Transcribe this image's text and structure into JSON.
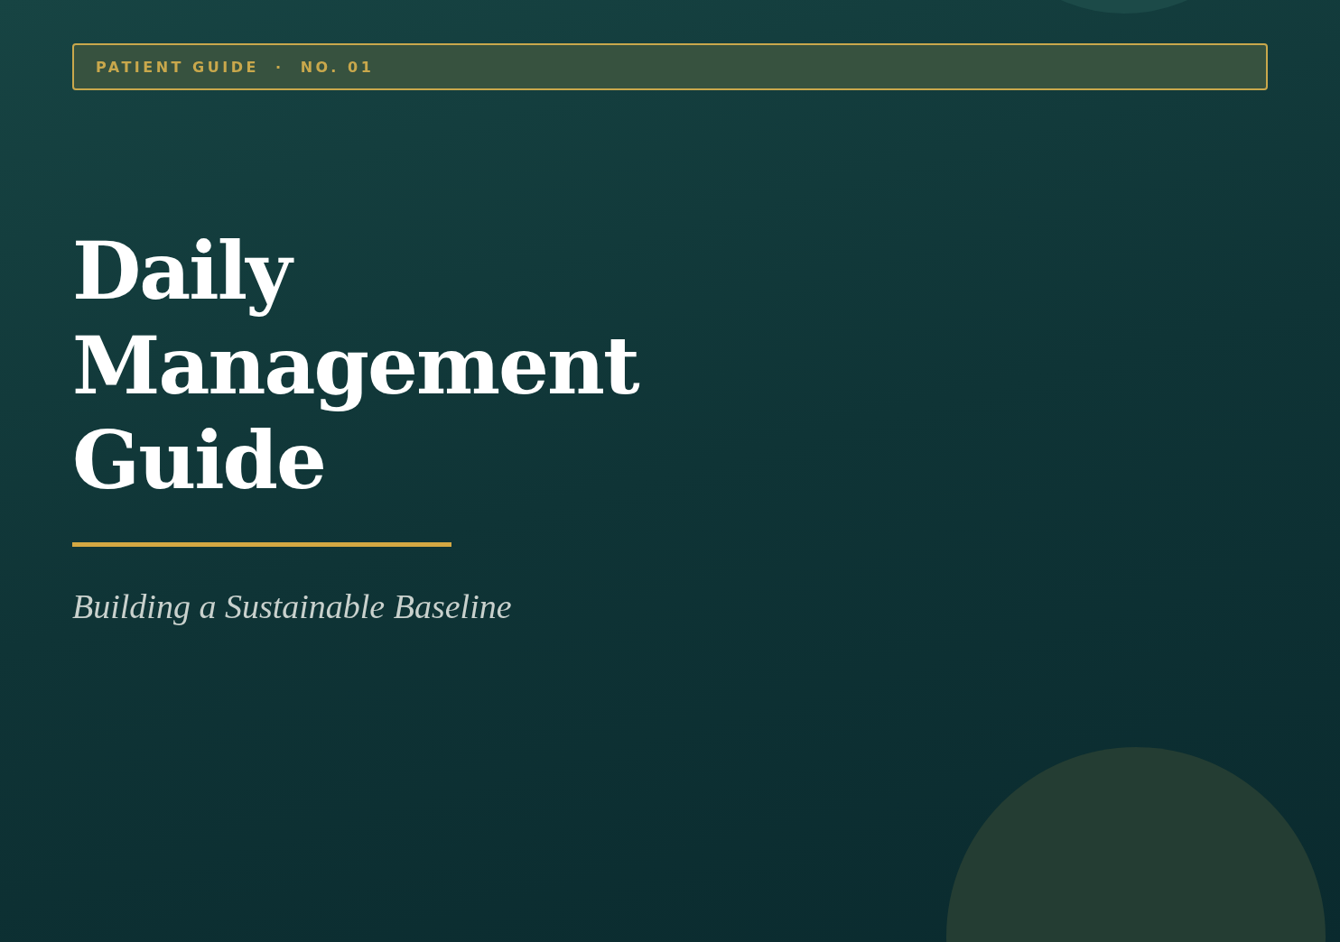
{
  "badge": {
    "text": "PATIENT GUIDE  ·  NO. 01"
  },
  "title_lines": [
    "Daily",
    "Management",
    "Guide"
  ],
  "subtitle": "Building a Sustainable Baseline"
}
